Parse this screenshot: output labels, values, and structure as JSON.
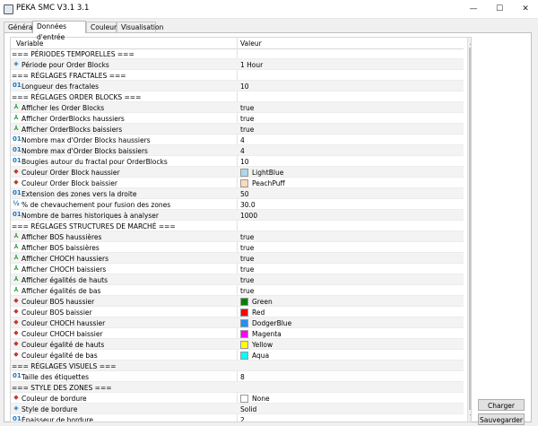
{
  "window": {
    "title": "PEKA SMC V3.1 3.1",
    "minimize": "—",
    "maximize": "☐",
    "close": "✕"
  },
  "tabs": [
    {
      "label": "Général"
    },
    {
      "label": "Données d'entrée"
    },
    {
      "label": "Couleurs"
    },
    {
      "label": "Visualisation"
    }
  ],
  "grid": {
    "col_variable": "Variable",
    "col_value": "Valeur",
    "rows": [
      {
        "label": "=== PÉRIODES TEMPORELLES ===",
        "value": "",
        "icon": "",
        "section": true
      },
      {
        "label": "Période pour Order Blocks",
        "value": "1 Hour",
        "icon": "enum"
      },
      {
        "label": "=== RÉGLAGES FRACTALES ===",
        "value": "",
        "icon": "",
        "section": true
      },
      {
        "label": "Longueur des fractales",
        "value": "10",
        "icon": "int"
      },
      {
        "label": "=== RÉGLAGES ORDER BLOCKS ===",
        "value": "",
        "icon": "",
        "section": true
      },
      {
        "label": "Afficher les Order Blocks",
        "value": "true",
        "icon": "bool"
      },
      {
        "label": "Afficher OrderBlocks haussiers",
        "value": "true",
        "icon": "bool"
      },
      {
        "label": "Afficher OrderBlocks baissiers",
        "value": "true",
        "icon": "bool"
      },
      {
        "label": "Nombre max d'Order Blocks haussiers",
        "value": "4",
        "icon": "int"
      },
      {
        "label": "Nombre max d'Order Blocks baissiers",
        "value": "4",
        "icon": "int"
      },
      {
        "label": "Bougies autour du fractal pour OrderBlocks",
        "value": "10",
        "icon": "int"
      },
      {
        "label": "Couleur Order Block haussier",
        "value": "LightBlue",
        "icon": "clr",
        "swatch": "#add8e6"
      },
      {
        "label": "Couleur Order Block baissier",
        "value": "PeachPuff",
        "icon": "clr",
        "swatch": "#ffdab9"
      },
      {
        "label": "Extension des zones vers la droite",
        "value": "50",
        "icon": "int"
      },
      {
        "label": "% de chevauchement pour fusion des zones",
        "value": "30.0",
        "icon": "dbl"
      },
      {
        "label": "Nombre de barres historiques à analyser",
        "value": "1000",
        "icon": "int"
      },
      {
        "label": "=== RÉGLAGES STRUCTURES DE MARCHÉ ===",
        "value": "",
        "icon": "",
        "section": true
      },
      {
        "label": "Afficher BOS haussières",
        "value": "true",
        "icon": "bool"
      },
      {
        "label": "Afficher BOS baissières",
        "value": "true",
        "icon": "bool"
      },
      {
        "label": "Afficher CHOCH haussiers",
        "value": "true",
        "icon": "bool"
      },
      {
        "label": "Afficher CHOCH baissiers",
        "value": "true",
        "icon": "bool"
      },
      {
        "label": "Afficher égalités de hauts",
        "value": "true",
        "icon": "bool"
      },
      {
        "label": "Afficher égalités de bas",
        "value": "true",
        "icon": "bool"
      },
      {
        "label": "Couleur BOS haussier",
        "value": "Green",
        "icon": "clr",
        "swatch": "#008000"
      },
      {
        "label": "Couleur BOS baissier",
        "value": "Red",
        "icon": "clr",
        "swatch": "#ff0000"
      },
      {
        "label": "Couleur CHOCH haussier",
        "value": "DodgerBlue",
        "icon": "clr",
        "swatch": "#1e90ff"
      },
      {
        "label": "Couleur CHOCH baissier",
        "value": "Magenta",
        "icon": "clr",
        "swatch": "#ff00ff"
      },
      {
        "label": "Couleur égalité de hauts",
        "value": "Yellow",
        "icon": "clr",
        "swatch": "#ffff00"
      },
      {
        "label": "Couleur égalité de bas",
        "value": "Aqua",
        "icon": "clr",
        "swatch": "#00ffff"
      },
      {
        "label": "=== RÉGLAGES VISUELS ===",
        "value": "",
        "icon": "",
        "section": true
      },
      {
        "label": "Taille des étiquettes",
        "value": "8",
        "icon": "int"
      },
      {
        "label": "=== STYLE DES ZONES ===",
        "value": "",
        "icon": "",
        "section": true
      },
      {
        "label": "Couleur de bordure",
        "value": "None",
        "icon": "clr",
        "swatch": "#ffffff"
      },
      {
        "label": "Style de bordure",
        "value": "Solid",
        "icon": "enum"
      },
      {
        "label": "Épaisseur de bordure",
        "value": "2",
        "icon": "int"
      }
    ]
  },
  "buttons": {
    "load": "Charger",
    "save": "Sauvegarder"
  }
}
